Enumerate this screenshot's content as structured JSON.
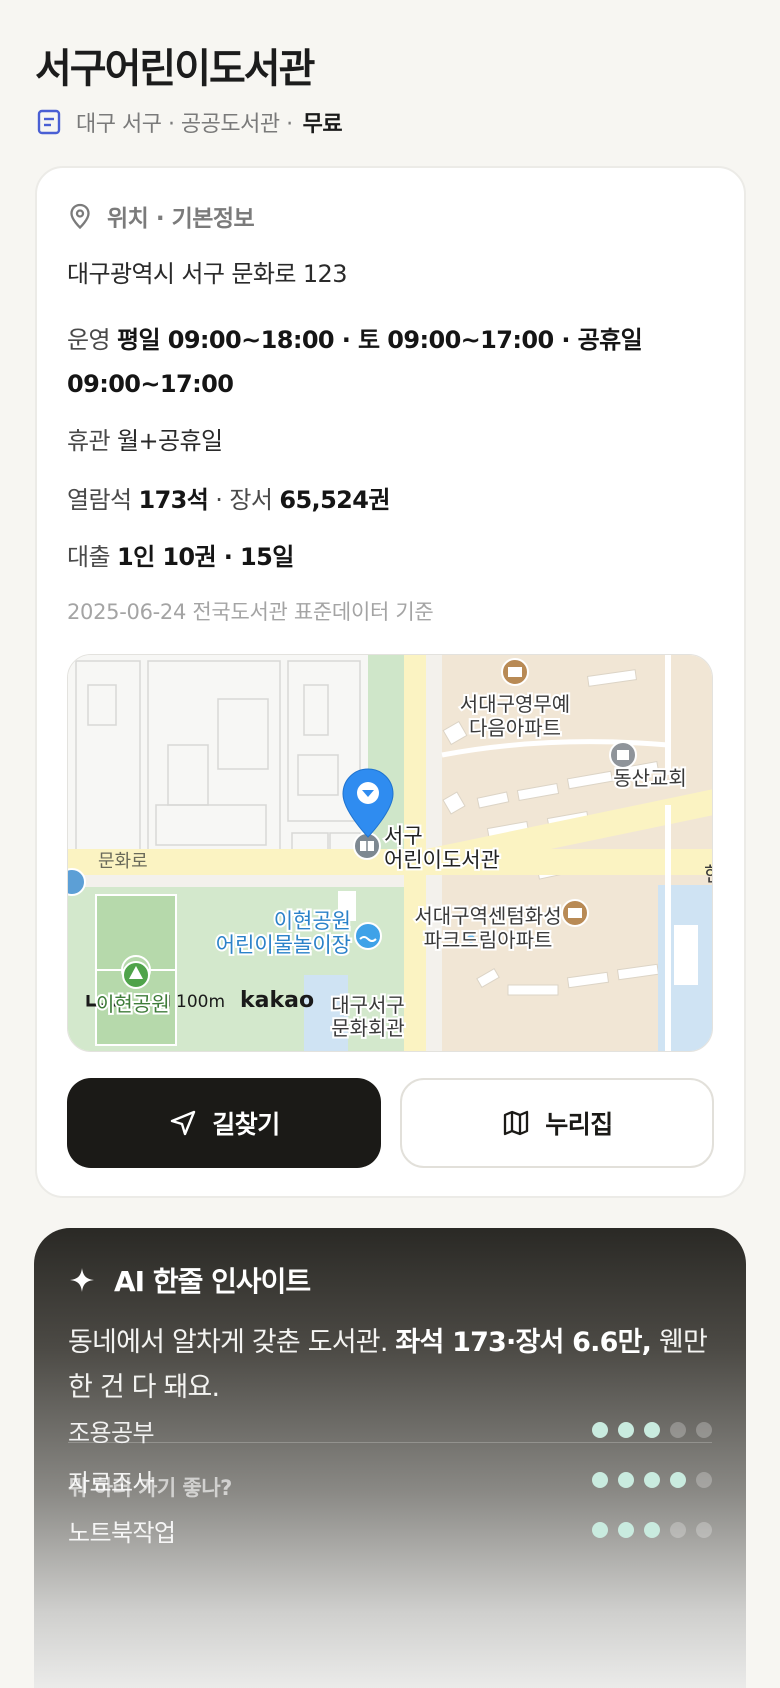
{
  "header": {
    "title": "서구어린이도서관",
    "sub_text": "대구 서구 · 공공도서관 ·",
    "price": "무료"
  },
  "info": {
    "section_title": "위치 · 기본정보",
    "address": "대구광역시 서구 문화로 123",
    "hours_label": "운영",
    "hours_value": "평일 09:00~18:00 · 토 09:00~17:00 · 공휴일 09:00~17:00",
    "closed_label": "휴관",
    "closed_value": "월+공휴일",
    "seats_label": "열람석",
    "seats_value": "173석",
    "books_sep": "· 장서",
    "books_value": "65,524권",
    "loan_label": "대출",
    "loan_value": "1인 10권 · 15일",
    "source": "2025-06-24 전국도서관 표준데이터 기준"
  },
  "map": {
    "labels": {
      "apt1_line1": "서대구영무예",
      "apt1_line2": "다음아파트",
      "church": "동산교회",
      "library_line1": "서구",
      "library_line2": "어린이도서관",
      "road": "문화로",
      "apt2_line1": "서대구역센텀화성",
      "apt2_line2": "파크드림아파트",
      "park_pool_line1": "이현공원",
      "park_pool_line2": "어린이물놀이장",
      "park": "이현공원",
      "hall_line1": "대구서구",
      "hall_line2": "문화회관",
      "edge_char": "현",
      "scale": "100m",
      "brand": "kakao"
    }
  },
  "buttons": {
    "directions": "길찾기",
    "website": "누리집"
  },
  "ai": {
    "title": "AI 한줄 인사이트",
    "text_plain": "동네에서 알차게 갖춘 도서관. ",
    "text_bold": "좌석 173·장서 6.6만,",
    "text_tail": " 웬만한 건 다 돼요.",
    "question": "뭐 하러 가기 좋나?",
    "purposes": [
      {
        "label": "조용공부",
        "level": 3,
        "max": 5
      },
      {
        "label": "자료조사",
        "level": 4,
        "max": 5
      },
      {
        "label": "노트북작업",
        "level": 3,
        "max": 5
      }
    ]
  },
  "colors": {
    "pin": "#2f8cf0",
    "dark_button": "#1b1a17",
    "dot_on": "#c9ebdf"
  }
}
